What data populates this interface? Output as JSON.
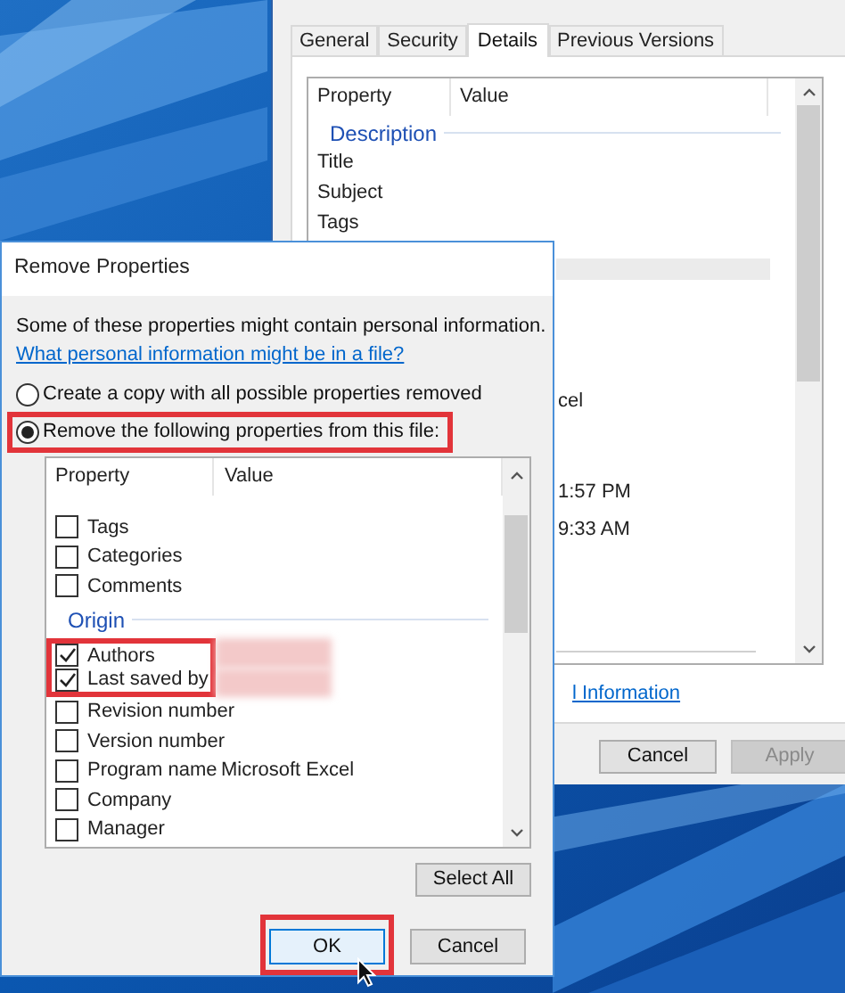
{
  "properties_window": {
    "tabs": [
      {
        "label": "General",
        "selected": false
      },
      {
        "label": "Security",
        "selected": false
      },
      {
        "label": "Details",
        "selected": true
      },
      {
        "label": "Previous Versions",
        "selected": false
      }
    ],
    "list": {
      "columns": [
        "Property",
        "Value"
      ],
      "group": "Description",
      "rows": [
        "Title",
        "Subject",
        "Tags"
      ],
      "fragments": [
        "cel",
        "1:57 PM",
        "9:33 AM"
      ]
    },
    "link": "l Information",
    "buttons": [
      {
        "label": "Cancel",
        "disabled": false
      },
      {
        "label": "Apply",
        "disabled": true
      }
    ]
  },
  "dialog": {
    "title": "Remove Properties",
    "message": "Some of these properties might contain personal information.",
    "link": "What personal information might be in a file?",
    "options": [
      {
        "label": "Create a copy with all possible properties removed",
        "selected": false,
        "highlighted": false
      },
      {
        "label": "Remove the following properties from this file:",
        "selected": true,
        "highlighted": true
      }
    ],
    "list": {
      "columns": [
        "Property",
        "Value"
      ],
      "items": [
        {
          "kind": "row",
          "name": "Tags",
          "checked": false,
          "highlighted": false
        },
        {
          "kind": "row",
          "name": "Categories",
          "checked": false,
          "highlighted": false
        },
        {
          "kind": "row",
          "name": "Comments",
          "checked": false,
          "highlighted": false
        },
        {
          "kind": "group",
          "name": "Origin"
        },
        {
          "kind": "row",
          "name": "Authors",
          "checked": true,
          "highlighted": true,
          "redacted": true
        },
        {
          "kind": "row",
          "name": "Last saved by",
          "checked": true,
          "highlighted": true,
          "redacted": true
        },
        {
          "kind": "row",
          "name": "Revision number",
          "checked": false,
          "highlighted": false
        },
        {
          "kind": "row",
          "name": "Version number",
          "checked": false,
          "highlighted": false
        },
        {
          "kind": "row",
          "name": "Program name",
          "value": "Microsoft Excel",
          "checked": false,
          "highlighted": false
        },
        {
          "kind": "row",
          "name": "Company",
          "checked": false,
          "highlighted": false
        },
        {
          "kind": "row",
          "name": "Manager",
          "checked": false,
          "highlighted": false
        }
      ]
    },
    "select_all": "Select All",
    "buttons": [
      {
        "label": "OK",
        "highlighted": true
      },
      {
        "label": "Cancel",
        "highlighted": false
      }
    ]
  }
}
